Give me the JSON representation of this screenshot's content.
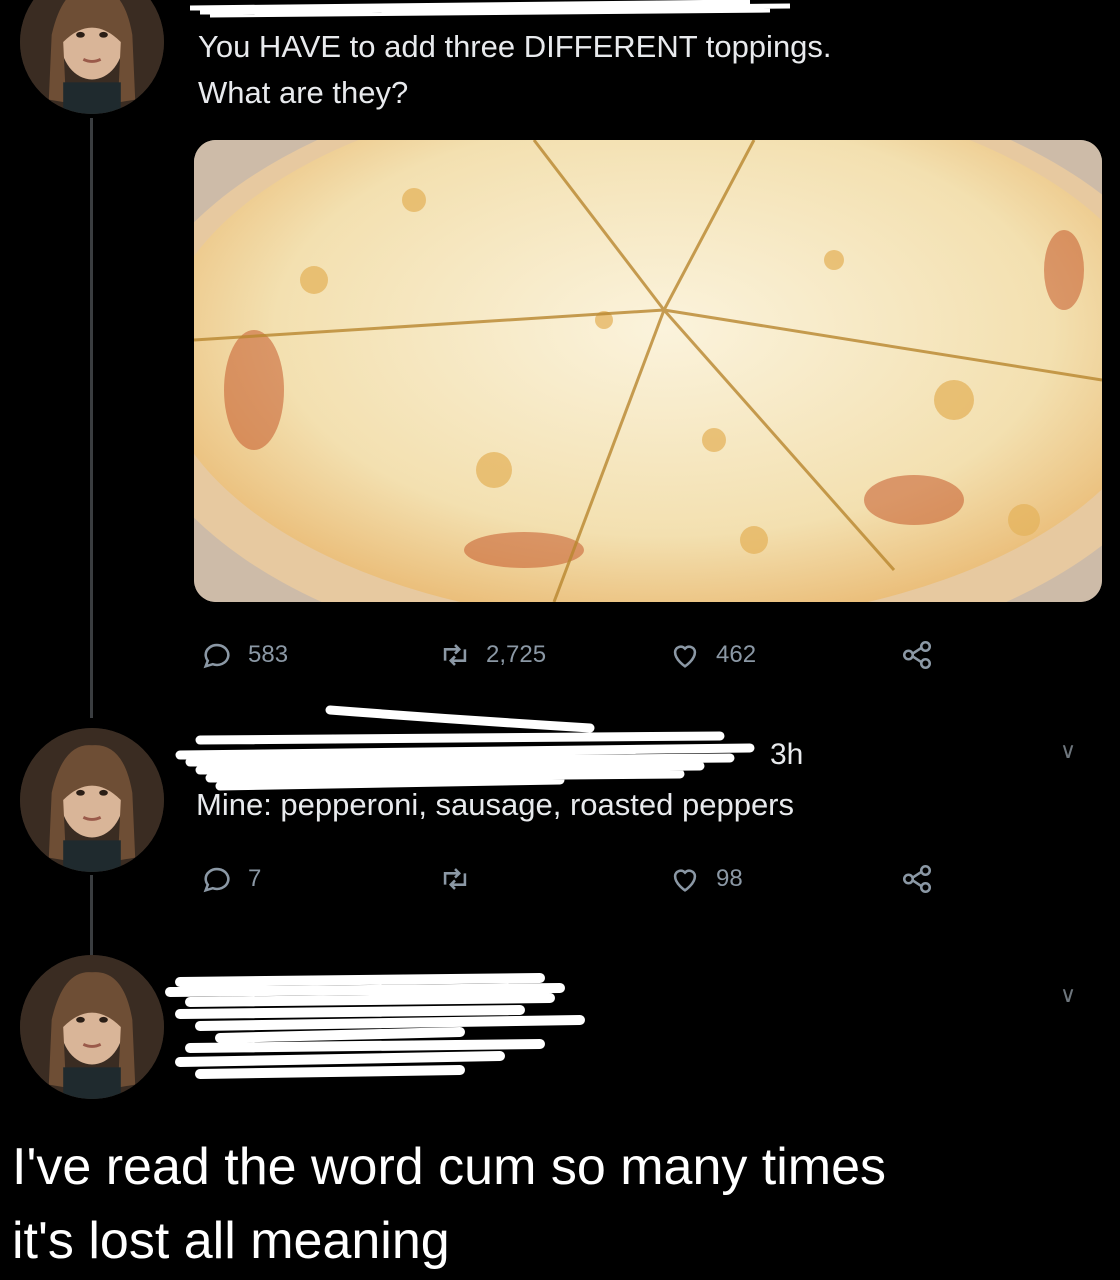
{
  "tweet1": {
    "text_line1": "You HAVE to add three DIFFERENT toppings.",
    "text_line2": "What are they?",
    "media": "pizza-photo",
    "replies": "583",
    "retweets": "2,725",
    "likes": "462"
  },
  "reply1": {
    "time": "3h",
    "text": "Mine: pepperoni, sausage, roasted peppers",
    "replies": "7",
    "retweets": "",
    "likes": "98"
  },
  "caption": {
    "line1": "I've read the word cum so many times",
    "line2": "it's lost all meaning"
  },
  "icons": {
    "reply": "reply-icon",
    "retweet": "retweet-icon",
    "like": "heart-icon",
    "share": "share-icon",
    "chevron": "chevron-down-icon"
  }
}
